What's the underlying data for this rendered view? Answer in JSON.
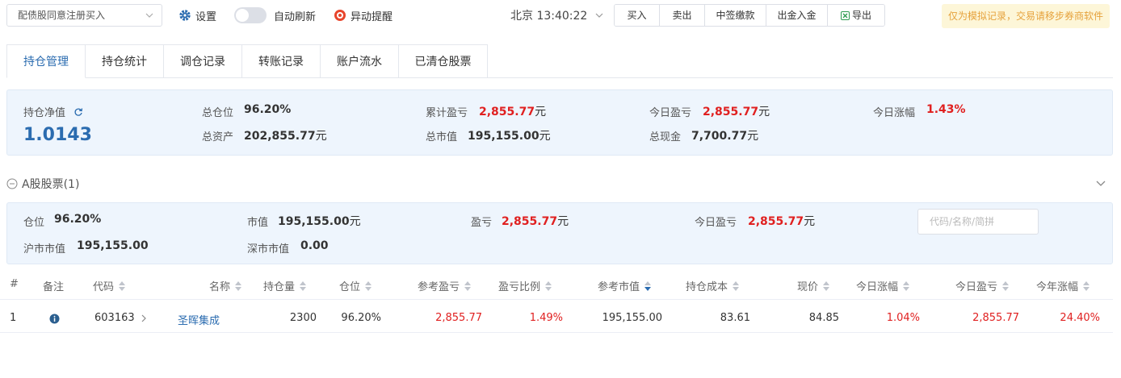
{
  "toolbar": {
    "preset_select": "配债股同意注册买入",
    "settings_label": "设置",
    "auto_refresh_label": "自动刷新",
    "alert_label": "异动提醒",
    "clock": "北京 13:40:22",
    "buttons": [
      "买入",
      "卖出",
      "中签缴款",
      "出金入金",
      "导出"
    ],
    "notice": "仅为模拟记录，交易请移步券商软件"
  },
  "tabs": [
    "持仓管理",
    "持仓统计",
    "调仓记录",
    "转账记录",
    "账户流水",
    "已清仓股票"
  ],
  "summary": {
    "nav_label": "持仓净值",
    "nav_value": "1.0143",
    "total_position_label": "总仓位",
    "total_position": "96.20%",
    "total_assets_label": "总资产",
    "total_assets": "202,855.77",
    "cum_pnl_label": "累计盈亏",
    "cum_pnl": "2,855.77",
    "total_mv_label": "总市值",
    "total_mv": "195,155.00",
    "today_pnl_label": "今日盈亏",
    "today_pnl": "2,855.77",
    "total_cash_label": "总现金",
    "total_cash": "7,700.77",
    "today_change_label": "今日涨幅",
    "today_change": "1.43%",
    "unit": "元"
  },
  "section": {
    "title": "A股股票(1)"
  },
  "stats": {
    "position_label": "仓位",
    "position": "96.20%",
    "mv_label": "市值",
    "mv": "195,155.00",
    "pnl_label": "盈亏",
    "pnl": "2,855.77",
    "today_pnl_label": "今日盈亏",
    "today_pnl": "2,855.77",
    "sh_mv_label": "沪市市值",
    "sh_mv": "195,155.00",
    "sz_mv_label": "深市市值",
    "sz_mv": "0.00",
    "unit": "元",
    "search_placeholder": "代码/名称/简拼"
  },
  "table": {
    "headers": {
      "index": "#",
      "note": "备注",
      "code": "代码",
      "name": "名称",
      "qty": "持仓量",
      "pos": "仓位",
      "ref_pnl": "参考盈亏",
      "pnl_ratio": "盈亏比例",
      "ref_mv": "参考市值",
      "cost": "持仓成本",
      "price": "现价",
      "today_change": "今日涨幅",
      "today_pnl": "今日盈亏",
      "ytd_change": "今年涨幅"
    },
    "rows": [
      {
        "index": "1",
        "code": "603163",
        "name": "圣晖集成",
        "qty": "2300",
        "pos": "96.20%",
        "ref_pnl": "2,855.77",
        "pnl_ratio": "1.49%",
        "ref_mv": "195,155.00",
        "cost": "83.61",
        "price": "84.85",
        "today_change": "1.04%",
        "today_pnl": "2,855.77",
        "ytd_change": "24.40%"
      }
    ]
  },
  "colors": {
    "accent": "#2b6cb0",
    "up_red": "#e02020",
    "panel_bg": "#eef5fd",
    "notice_bg": "#fdf6d8",
    "notice_text": "#e6a23c"
  }
}
